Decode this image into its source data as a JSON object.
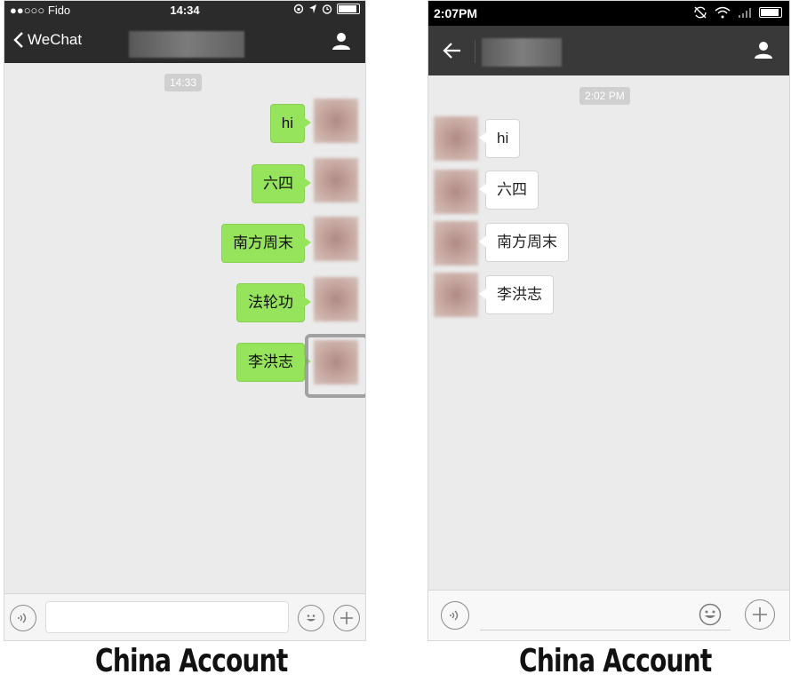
{
  "left": {
    "status": {
      "carrier": "●●○○○ Fido",
      "time": "14:34"
    },
    "nav": {
      "back_label": "WeChat"
    },
    "timestamp": "14:33",
    "messages": [
      "hi",
      "六四",
      "南方周末",
      "法轮功",
      "李洪志"
    ],
    "caption": "China Account"
  },
  "right": {
    "status": {
      "time": "2:07PM"
    },
    "timestamp": "2:02 PM",
    "messages": [
      "hi",
      "六四",
      "南方周末",
      "李洪志"
    ],
    "caption": "China Account"
  },
  "colors": {
    "sent_bubble": "#96e35c",
    "chat_background": "#ebebeb",
    "header": "#2b2b2b"
  }
}
